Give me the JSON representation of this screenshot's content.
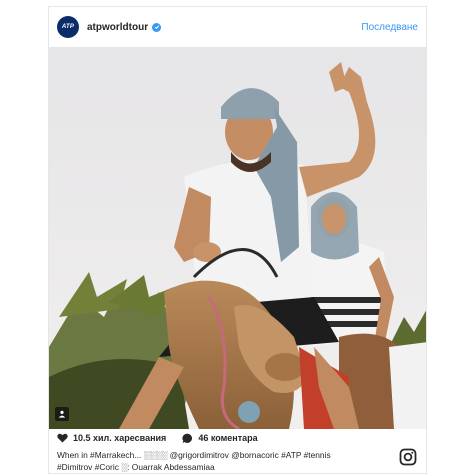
{
  "post": {
    "account": {
      "avatar_text": "ATP",
      "username": "atpworldtour",
      "verified_icon": "verified-badge-icon",
      "follow_label": "Последване"
    },
    "photo": {
      "description_icon": "person-tag-icon"
    },
    "likes": {
      "icon": "heart-icon",
      "text": "10.5 хил. харесвания"
    },
    "comments": {
      "icon": "speech-bubble-icon",
      "text": "46 коментара"
    },
    "caption_line1": "When in #Marrakech... ░░░░ @grigordimitrov @bornacoric #ATP #tennis",
    "caption_line2": "#Dimitrov #Coric ░: Ouarrak Abdessamiaa",
    "brand_icon": "instagram-icon"
  },
  "colors": {
    "link": "#3897f0",
    "avatar_bg": "#0b2c6b",
    "border": "#e6e6e6"
  }
}
